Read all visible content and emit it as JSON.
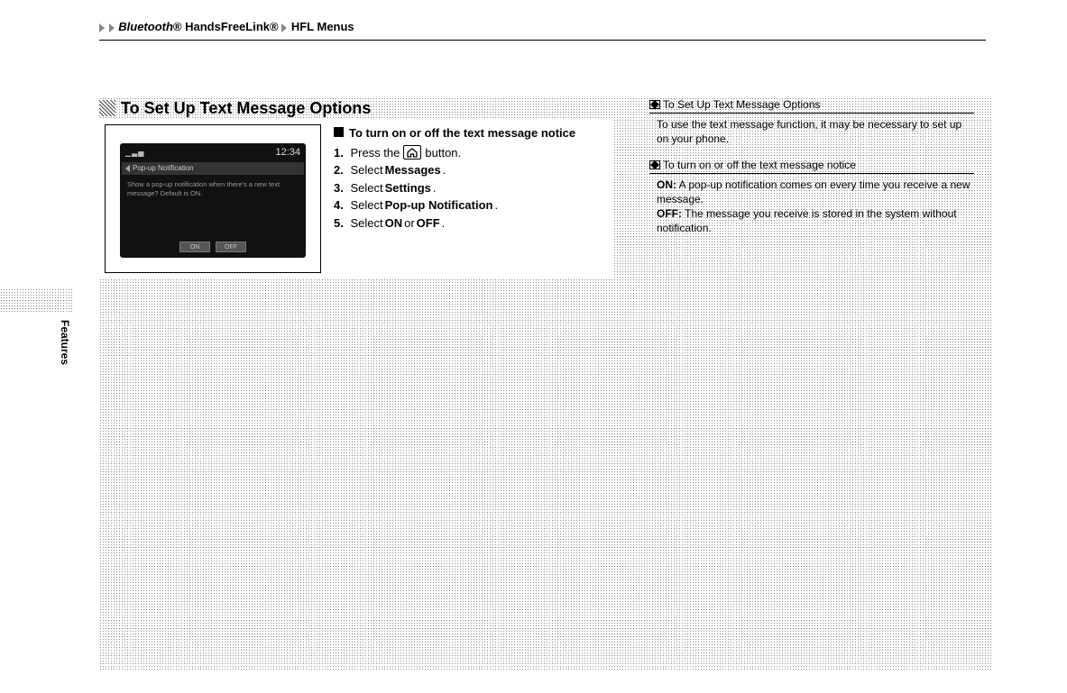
{
  "breadcrumb": {
    "seg1_italic": "Bluetooth",
    "seg1_suffix": "® HandsFreeLink®",
    "seg2": "HFL Menus"
  },
  "side_tab": "Features",
  "section_title": "To Set Up Text Message Options",
  "screenshot": {
    "clock": "12:34",
    "title": "Pop-up Notification",
    "body_line1": "Show a pop-up notification when there's a new text",
    "body_line2": "message? Default is ON.",
    "btn_on": "ON",
    "btn_off": "OFF"
  },
  "steps": {
    "subhead": "To turn on or off the text message notice",
    "items": [
      {
        "num": "1.",
        "pre": "Press the ",
        "post": " button."
      },
      {
        "num": "2.",
        "pre": "Select ",
        "bold": "Messages",
        "post": "."
      },
      {
        "num": "3.",
        "pre": "Select ",
        "bold": "Settings",
        "post": "."
      },
      {
        "num": "4.",
        "pre": "Select ",
        "bold": "Pop-up Notification",
        "post": "."
      },
      {
        "num": "5.",
        "pre": "Select ",
        "bold": "ON",
        "mid": " or ",
        "bold2": "OFF",
        "post": "."
      }
    ]
  },
  "notes": {
    "n1_title": "To Set Up Text Message Options",
    "n1_body": "To use the text message function, it may be necessary to set up on your phone.",
    "n2_title": "To turn on or off the text message notice",
    "n2_on_label": "ON:",
    "n2_on_text": " A pop-up notification comes on every time you receive a new message.",
    "n2_off_label": "OFF:",
    "n2_off_text": " The message you receive is stored in the system without notification."
  }
}
